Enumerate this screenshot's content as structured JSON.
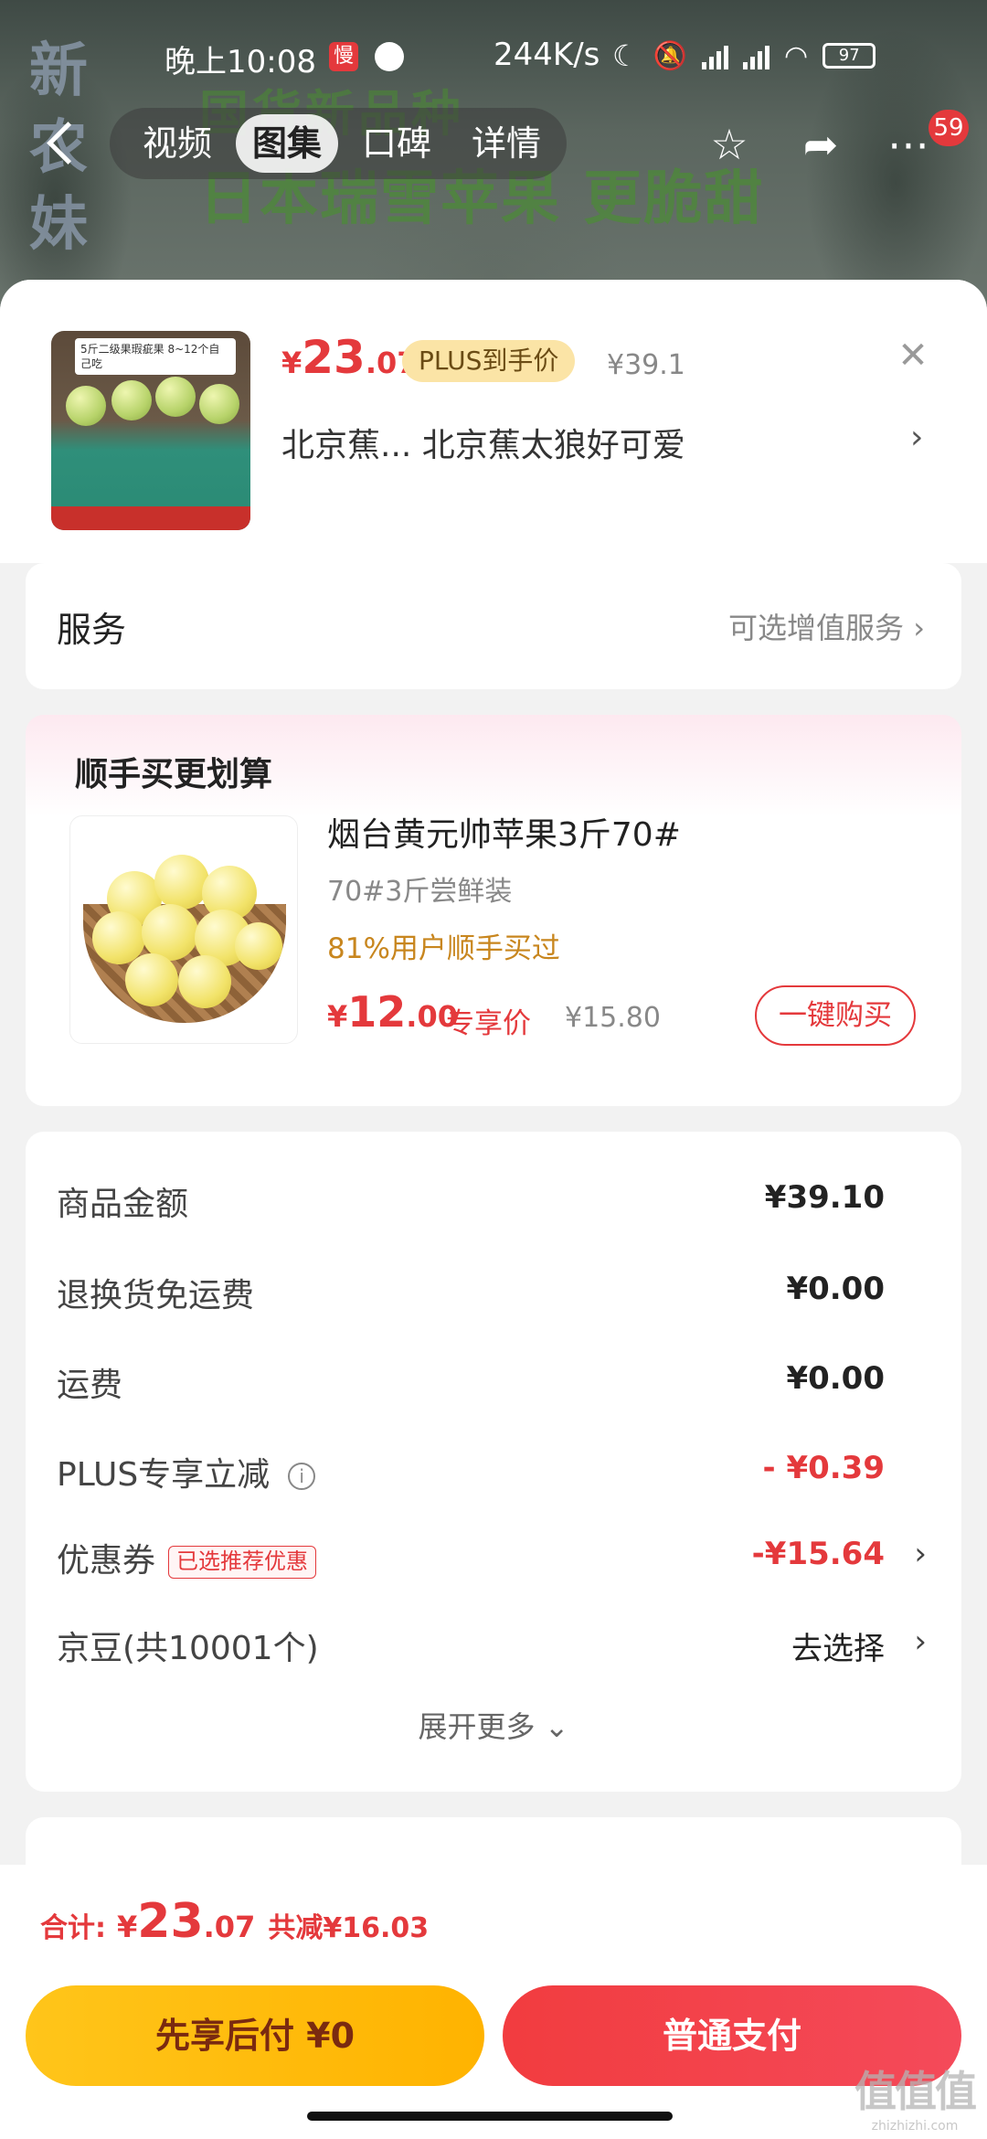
{
  "status_bar": {
    "time": "晚上10:08",
    "network_speed": "244K/s",
    "battery": "97"
  },
  "banner": {
    "side_text": "新农妹",
    "line1": "国货新品种",
    "line2": "日本瑞雪苹果 更脆甜"
  },
  "nav": {
    "tabs": [
      {
        "label": "视频",
        "active": false
      },
      {
        "label": "图集",
        "active": true
      },
      {
        "label": "口碑",
        "active": false
      },
      {
        "label": "详情",
        "active": false
      }
    ],
    "more_badge": "59"
  },
  "product": {
    "thumb_note": "5斤二级果瑕疵果 8~12个自己吃",
    "price_yen": "¥",
    "price_int": "23",
    "price_dec": ".07",
    "plus_tag": "PLUS到手价",
    "original_price": "¥39.1",
    "spec": "北京蕉... 北京蕉太狼好可爱"
  },
  "service": {
    "title": "服务",
    "hint": "可选增值服务"
  },
  "upsell": {
    "title": "顺手买更划算",
    "name": "烟台黄元帅苹果3斤70#",
    "spec": "70#3斤尝鲜装",
    "bought": "81%用户顺手买过",
    "price_yen": "¥",
    "price_int": "12",
    "price_dec": ".00",
    "exclusive": "专享价",
    "original_price": "¥15.80",
    "buy_button": "一键购买"
  },
  "summary": {
    "rows": [
      {
        "label": "商品金额",
        "value": "¥39.10"
      },
      {
        "label": "退换货免运费",
        "value": "¥0.00"
      },
      {
        "label": "运费",
        "value": "¥0.00"
      },
      {
        "label": "PLUS专享立减",
        "value": "- ¥0.39"
      },
      {
        "label": "优惠券",
        "tag": "已选推荐优惠",
        "value": "-¥15.64"
      },
      {
        "label": "京豆(共10001个)",
        "value": "去选择"
      }
    ],
    "expand": "展开更多"
  },
  "footer": {
    "total_label": "合计:",
    "total_yen": "¥",
    "total_int": "23",
    "total_dec": ".07",
    "saved": "共减¥16.03",
    "pay_later": "先享后付 ¥0",
    "pay_normal": "普通支付"
  },
  "watermark": {
    "big": "值值值",
    "small": "zhizhizhi.com"
  },
  "colors": {
    "accent": "#e4393c",
    "plus_tag_bg": "#fbe4a6",
    "pay_later": "#ffc51a"
  }
}
